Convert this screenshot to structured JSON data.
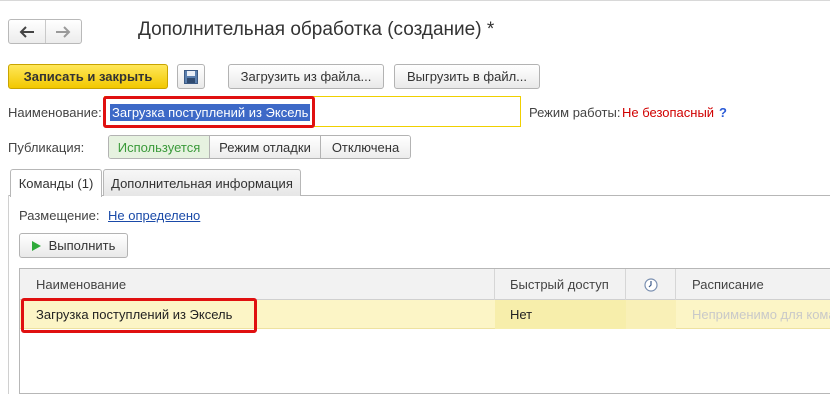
{
  "window": {
    "title": "Дополнительная обработка (создание) *"
  },
  "nav": {
    "back_icon": "arrow-left-icon",
    "forward_icon": "arrow-right-icon"
  },
  "toolbar": {
    "save_close_label": "Записать и закрыть",
    "save_icon": "floppy-disk-icon",
    "load_label": "Загрузить из файла...",
    "unload_label": "Выгрузить в файл..."
  },
  "form": {
    "name_label": "Наименование:",
    "name_value": "Загрузка поступлений из Эксель",
    "mode_label": "Режим работы:",
    "mode_value": "Не безопасный",
    "mode_help": "?",
    "publication_label": "Публикация:",
    "publication_options": [
      "Используется",
      "Режим отладки",
      "Отключена"
    ],
    "publication_selected": "Используется"
  },
  "tabs": [
    {
      "label": "Команды (1)",
      "active": true
    },
    {
      "label": "Дополнительная информация",
      "active": false
    }
  ],
  "commands": {
    "placement_label": "Размещение:",
    "placement_value": "Не определено",
    "run_label": "Выполнить",
    "run_icon": "play-icon",
    "table": {
      "columns": [
        "Наименование",
        "Быстрый доступ",
        "clock-icon",
        "Расписание"
      ],
      "rows": [
        {
          "name": "Загрузка поступлений из Эксель",
          "quick_access": "Нет",
          "schedule": "Неприменимо для команд"
        }
      ]
    }
  },
  "colors": {
    "primary_button": "#f2c800",
    "selection": "#3d69c7",
    "highlight_box": "#e01010",
    "mode_value": "#d00000",
    "link": "#1a4aa8",
    "active_option": "#3a9a3a",
    "selected_row": "#fcf5c6"
  }
}
